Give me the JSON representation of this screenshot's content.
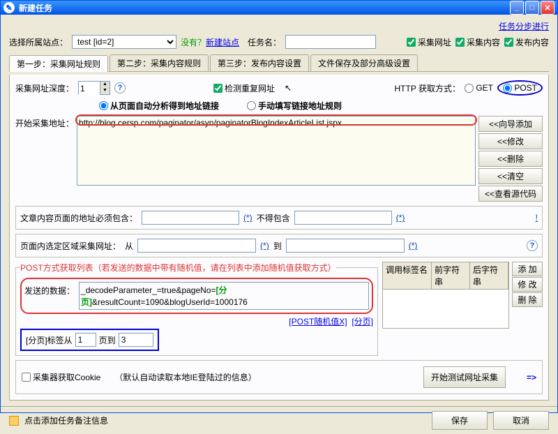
{
  "title": "新建任务",
  "stepProgress": "任务分步进行",
  "siteLabel": "选择所属站点：",
  "siteValue": "test [id=2]",
  "newSitePrompt": "没有？",
  "newSiteLink": "新建站点",
  "taskNameLabel": "任务名：",
  "taskNameValue": "",
  "topChecks": {
    "collectUrl": "采集网址",
    "collectContent": "采集内容",
    "publishContent": "发布内容"
  },
  "tabs": [
    "第一步：采集网址规则",
    "第二步：采集内容规则",
    "第三步：发布内容设置",
    "文件保存及部分高级设置"
  ],
  "depthLabel": "采集网址深度：",
  "depthValue": "1",
  "detectDup": "检测重复网址",
  "httpMethodLabel": "HTTP 获取方式：",
  "httpGet": "GET",
  "httpPost": "POST",
  "autoAnalyze": "从页面自动分析得到地址链接",
  "manualRule": "手动填写链接地址规则",
  "startUrlLabel": "开始采集地址：",
  "startUrl": "http://blog.cersp.com/paginator/asyn/paginatorBlogIndexArticleList.jspx",
  "sideBtns": [
    "<<向导添加",
    "<<修改",
    "<<删除",
    "<<清空",
    "<<查看源代码"
  ],
  "mustContainLabel": "文章内容页面的地址必须包含：",
  "notContainLabel": "不得包含",
  "star": "(*)",
  "excl": "!",
  "rangeLabel": "页面内选定区域采集网址：",
  "rangeFrom": "从",
  "rangeTo": "到",
  "postLegend": "POST方式获取列表（若发送的数据中带有随机值，请在列表中添加随机值获取方式）",
  "postDataLabel": "发送的数据：",
  "postDataBefore": "_decodeParameter_=true&pageNo=",
  "postDataHl": "[分页]",
  "postDataAfter": "&resultCount=1090&blogUserId=1000176",
  "postRandLink": "[POST随机值X]",
  "pageSplitLink": "[分页]",
  "pageTagLabel": "[分页]标签从",
  "pageFrom": "1",
  "pageToLabel": "页到",
  "pageTo": "3",
  "tableHdr": {
    "c1": "调用标签名",
    "c2": "前字符串",
    "c3": "后字符串"
  },
  "smallBtns": [
    "添 加",
    "修 改",
    "删 除"
  ],
  "cookieLabel": "采集器获取Cookie",
  "cookieHint": "（默认自动读取本地IE登陆过的信息）",
  "startTestBtn": "开始测试网址采集",
  "footerHint": "点击添加任务备注信息",
  "saveBtn": "保存",
  "cancelBtn": "取消"
}
